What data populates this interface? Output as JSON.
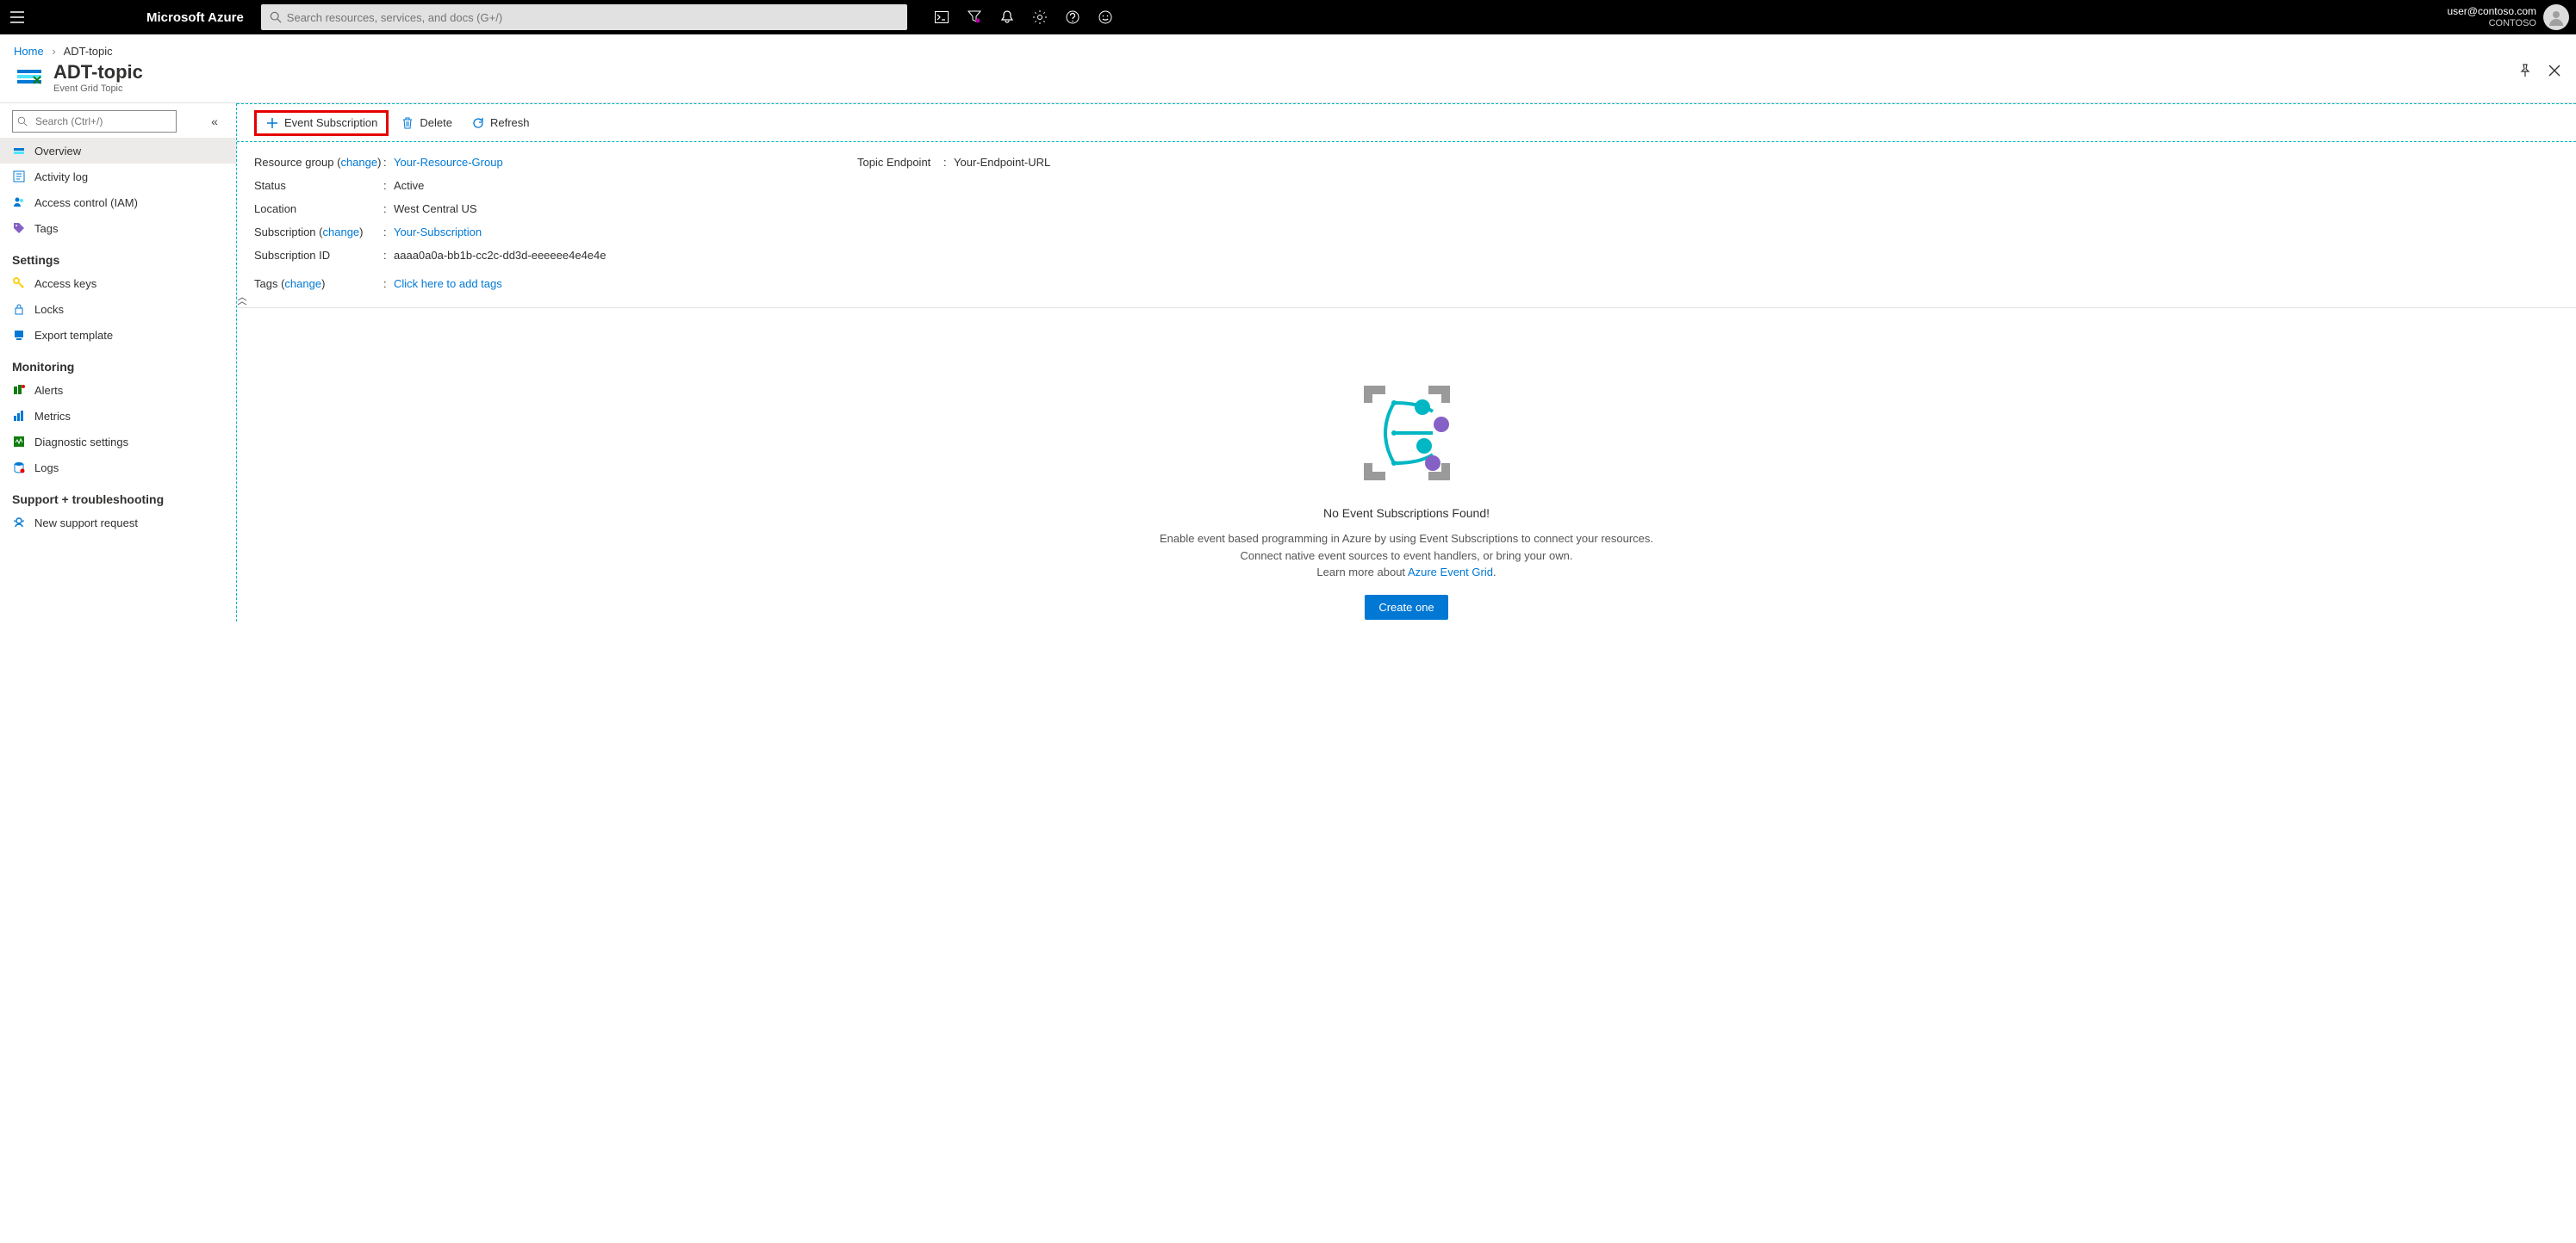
{
  "topbar": {
    "brand": "Microsoft Azure",
    "search_placeholder": "Search resources, services, and docs (G+/)",
    "user_email": "user@contoso.com",
    "tenant": "CONTOSO"
  },
  "breadcrumb": {
    "home": "Home",
    "current": "ADT-topic"
  },
  "page": {
    "title": "ADT-topic",
    "subtitle": "Event Grid Topic"
  },
  "sidebar": {
    "search_placeholder": "Search (Ctrl+/)",
    "items": [
      "Overview",
      "Activity log",
      "Access control (IAM)",
      "Tags"
    ],
    "groups": [
      {
        "label": "Settings",
        "items": [
          "Access keys",
          "Locks",
          "Export template"
        ]
      },
      {
        "label": "Monitoring",
        "items": [
          "Alerts",
          "Metrics",
          "Diagnostic settings",
          "Logs"
        ]
      },
      {
        "label": "Support + troubleshooting",
        "items": [
          "New support request"
        ]
      }
    ]
  },
  "commands": {
    "add": "Event Subscription",
    "delete": "Delete",
    "refresh": "Refresh"
  },
  "essentials": {
    "resource_group_label": "Resource group",
    "resource_group_value": "Your-Resource-Group",
    "status_label": "Status",
    "status_value": "Active",
    "location_label": "Location",
    "location_value": "West Central US",
    "subscription_label": "Subscription",
    "subscription_value": "Your-Subscription",
    "subscription_id_label": "Subscription ID",
    "subscription_id_value": "aaaa0a0a-bb1b-cc2c-dd3d-eeeeee4e4e4e",
    "tags_label": "Tags",
    "tags_value": "Click here to add tags",
    "change": "change",
    "endpoint_label": "Topic Endpoint",
    "endpoint_value": "Your-Endpoint-URL"
  },
  "empty": {
    "title": "No Event Subscriptions Found!",
    "line1": "Enable event based programming in Azure by using Event Subscriptions to connect your resources.",
    "line2": "Connect native event sources to event handlers, or bring your own.",
    "learn_prefix": "Learn more about ",
    "learn_link": "Azure Event Grid",
    "button": "Create one"
  }
}
